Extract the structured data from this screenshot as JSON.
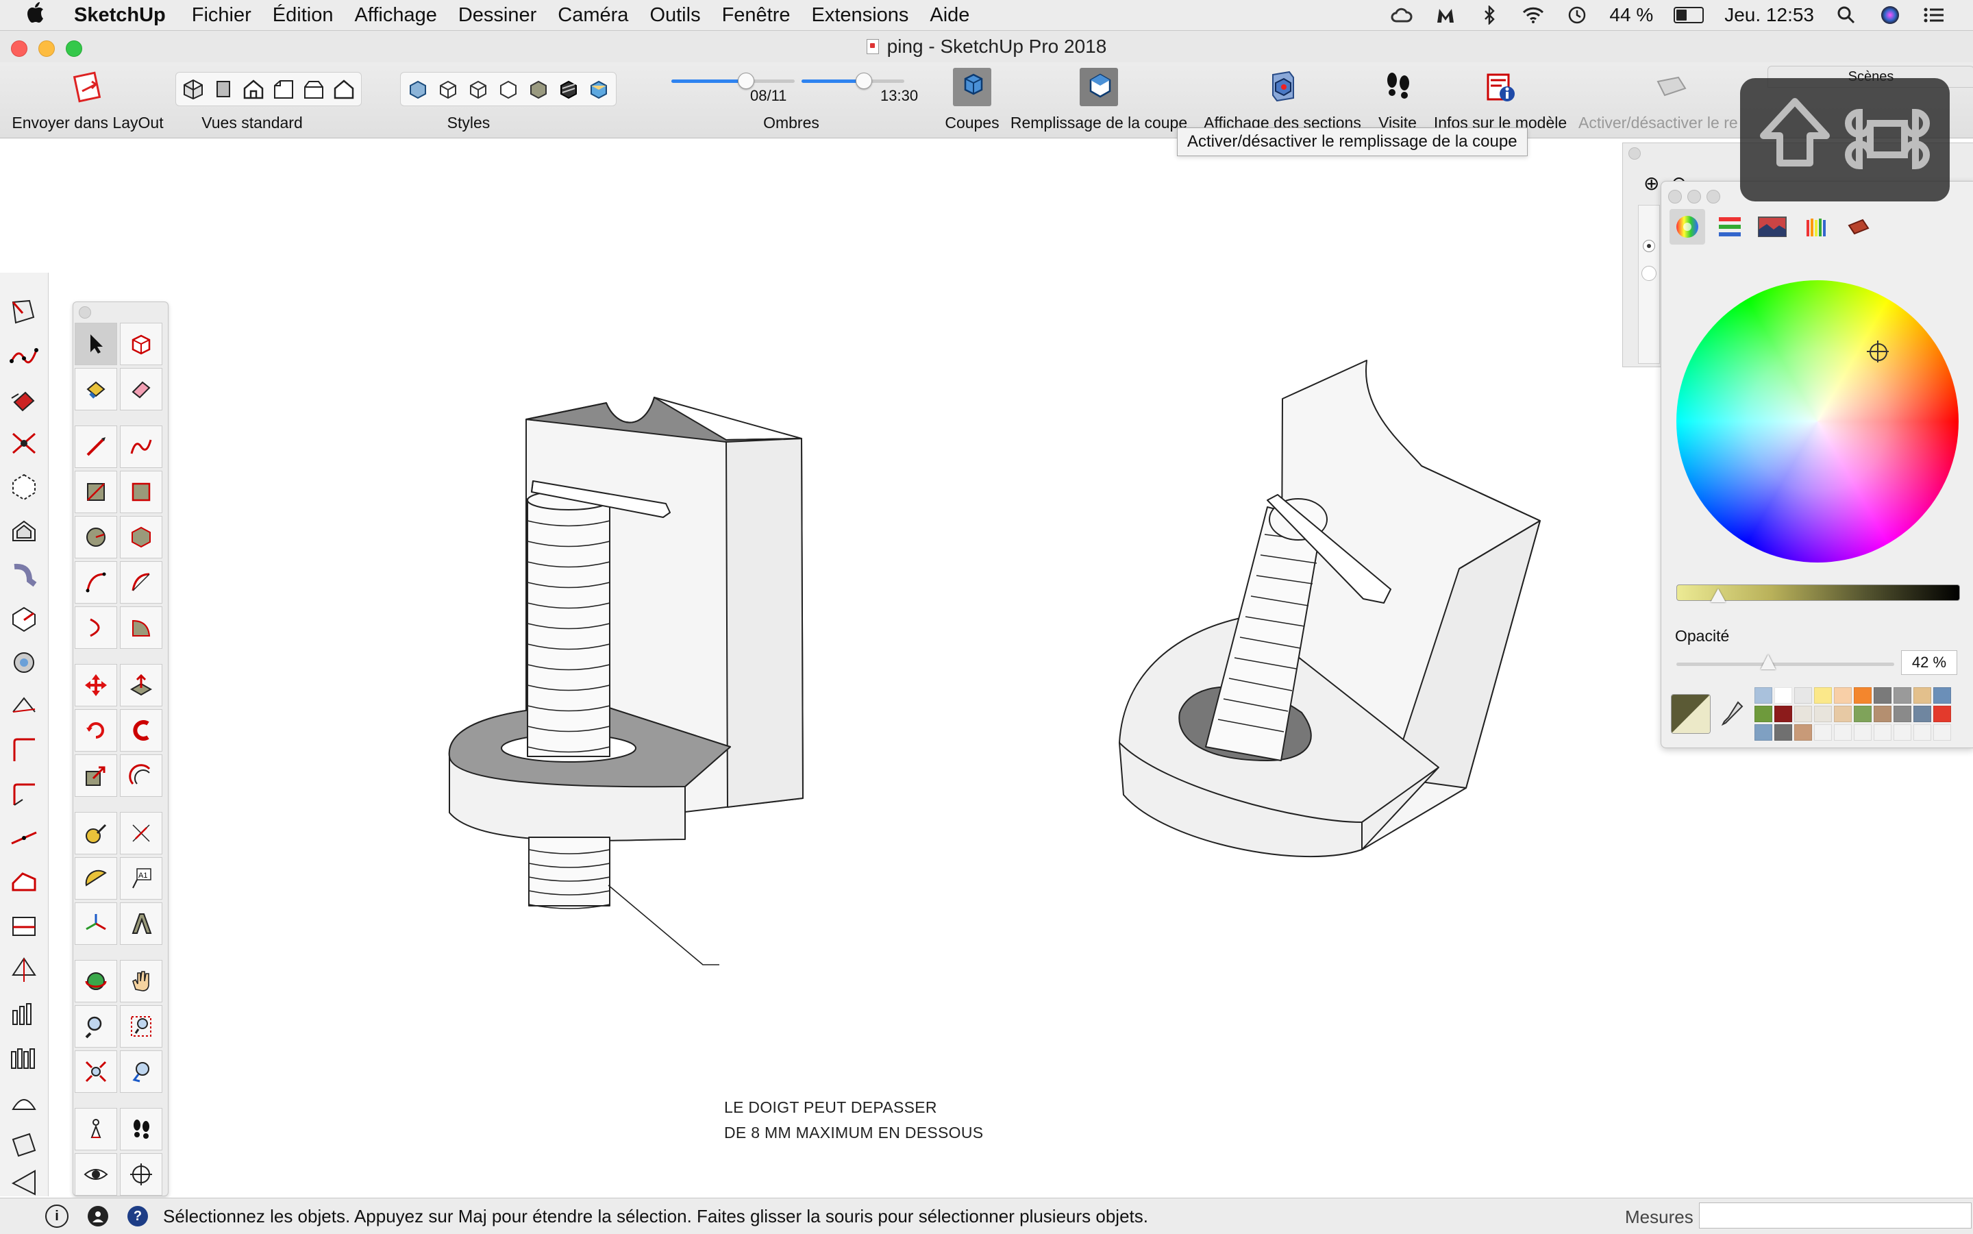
{
  "menubar": {
    "items": [
      "SketchUp",
      "Fichier",
      "Édition",
      "Affichage",
      "Dessiner",
      "Caméra",
      "Outils",
      "Fenêtre",
      "Extensions",
      "Aide"
    ],
    "battery": "44 %",
    "clock": "Jeu. 12:53"
  },
  "window": {
    "title": "ping - SketchUp Pro 2018"
  },
  "toolbar": {
    "send_layout": "Envoyer dans LayOut",
    "standard_views": "Vues standard",
    "styles": "Styles",
    "shadows": "Ombres",
    "shadow_date": "08/11",
    "shadow_time": "13:30",
    "sections": "Coupes",
    "section_fill": "Remplissage de la coupe",
    "section_display": "Affichage des sections",
    "tour": "Visite",
    "model_info": "Infos sur le modèle",
    "toggle": "Activer/désactiver le re",
    "shadow_date_fraction": 0.6,
    "shadow_time_fraction": 0.6
  },
  "tooltip": "Activer/désactiver le remplissage de la coupe",
  "canvas": {
    "callout_line1": "LE DOIGT PEUT DEPASSER",
    "callout_line2": "DE 8 MM MAXIMUM EN DESSOUS"
  },
  "panels": {
    "scenes": "Scènes"
  },
  "colors_panel": {
    "opacity_label": "Opacité",
    "opacity_value": "42 %",
    "opacity_fraction": 0.42,
    "swatches": [
      "#a9c1dc",
      "#ffffff",
      "#e7e7e7",
      "#fbe88a",
      "#f8cfa7",
      "#f3862d",
      "#7a7a7a",
      "#9a9a9a",
      "#e3c08c",
      "#6b8fb8",
      "#6e9a3c",
      "#8c1b1b",
      "#e8e4dc",
      "#e8e4dc",
      "#e7c9a4",
      "#7fa35a",
      "#b48f70",
      "#8a8a8a",
      "#6f86a0",
      "#e33a2c",
      "#7fa0c2",
      "#707070",
      "#c89a78",
      "#f2f2f2",
      "#f2f2f2",
      "#f2f2f2",
      "#f2f2f2",
      "#f2f2f2",
      "#f2f2f2",
      "#f2f2f2"
    ]
  },
  "statusbar": {
    "message": "Sélectionnez les objets. Appuyez sur Maj pour étendre la sélection. Faites glisser la souris pour sélectionner plusieurs objets.",
    "measures_label": "Mesures",
    "measures_value": ""
  }
}
